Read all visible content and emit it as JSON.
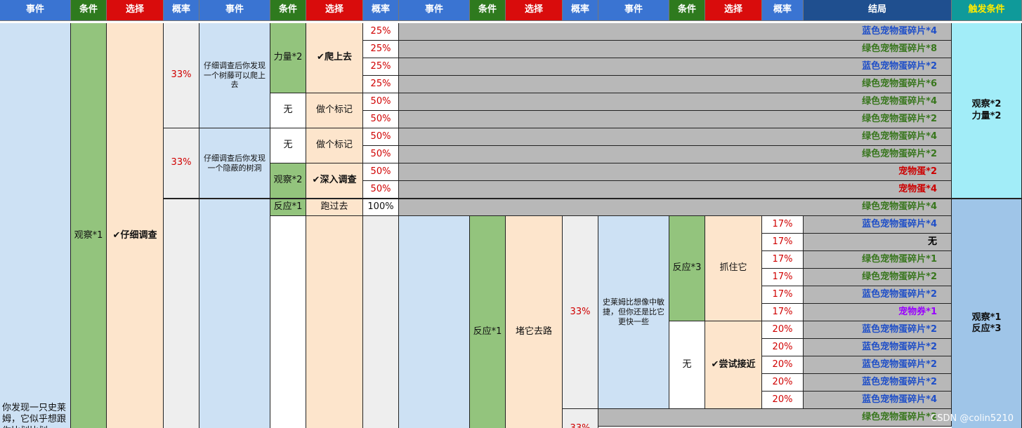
{
  "colors": {
    "header_blue": "#3a74d2",
    "header_green": "#2e7a1e",
    "header_red": "#d90c0c",
    "header_navy": "#1f4f8f",
    "header_teal": "#0f9a9a",
    "result_blue": "#1f4fc8",
    "result_green": "#38761d",
    "result_red": "#cc0000",
    "result_purple": "#9900ff"
  },
  "headers": [
    "事件",
    "条件",
    "选择",
    "概率",
    "事件",
    "条件",
    "选择",
    "概率",
    "事件",
    "条件",
    "选择",
    "概率",
    "事件",
    "条件",
    "选择",
    "概率",
    "结局",
    "触发条件"
  ],
  "main": {
    "event_text": "你发现一只史莱姆，它似乎想跟你比划比划，一直在挑衅",
    "condition": "观察*1",
    "choice": "✔仔细调查"
  },
  "branch_a": {
    "prob": "33%",
    "event": "仔细调查后你发现一个树藤可以爬上去",
    "cond_1": "力量*2",
    "choice_1": "✔爬上去",
    "cond_2": "无",
    "choice_2": "做个标记",
    "trigger": "观察*2\n力量*2"
  },
  "branch_b": {
    "prob": "33%",
    "event": "仔细调查后你发现一个隐蔽的树洞",
    "cond_1": "无",
    "choice_1": "做个标记",
    "cond_2": "观察*2",
    "choice_2": "✔深入调查"
  },
  "branch_c": {
    "cond_run": "反应*1",
    "choice_run": "跑过去",
    "prob_run": "100%",
    "cond_block": "反应*1",
    "choice_block": "堵它去路",
    "prob_block": "33%",
    "event_2": "史莱姆比想像中敏捷，但你还是比它更快一些",
    "cond_catch": "反应*3",
    "choice_catch": "抓住它",
    "cond_approach": "无",
    "choice_approach": "✔尝试接近",
    "prob_last": "33%",
    "trigger": "观察*1\n反应*3"
  },
  "rows": [
    {
      "prob": "25%",
      "result": "蓝色宠物蛋碎片*4",
      "color": "blue"
    },
    {
      "prob": "25%",
      "result": "绿色宠物蛋碎片*8",
      "color": "green"
    },
    {
      "prob": "25%",
      "result": "蓝色宠物蛋碎片*2",
      "color": "blue"
    },
    {
      "prob": "25%",
      "result": "绿色宠物蛋碎片*6",
      "color": "green"
    },
    {
      "prob": "50%",
      "result": "绿色宠物蛋碎片*4",
      "color": "green"
    },
    {
      "prob": "50%",
      "result": "绿色宠物蛋碎片*2",
      "color": "green"
    },
    {
      "prob": "50%",
      "result": "绿色宠物蛋碎片*4",
      "color": "green"
    },
    {
      "prob": "50%",
      "result": "绿色宠物蛋碎片*2",
      "color": "green"
    },
    {
      "prob": "50%",
      "result": "宠物蛋*2",
      "color": "red"
    },
    {
      "prob": "50%",
      "result": "宠物蛋*4",
      "color": "red"
    },
    {
      "prob": "",
      "result": "绿色宠物蛋碎片*4",
      "color": "green"
    },
    {
      "prob": "17%",
      "result": "蓝色宠物蛋碎片*4",
      "color": "blue"
    },
    {
      "prob": "17%",
      "result": "无",
      "color": "black"
    },
    {
      "prob": "17%",
      "result": "绿色宠物蛋碎片*1",
      "color": "green"
    },
    {
      "prob": "17%",
      "result": "绿色宠物蛋碎片*2",
      "color": "green"
    },
    {
      "prob": "17%",
      "result": "蓝色宠物蛋碎片*2",
      "color": "blue"
    },
    {
      "prob": "17%",
      "result": "宠物券*1",
      "color": "purple"
    },
    {
      "prob": "20%",
      "result": "蓝色宠物蛋碎片*2",
      "color": "blue"
    },
    {
      "prob": "20%",
      "result": "蓝色宠物蛋碎片*2",
      "color": "blue"
    },
    {
      "prob": "20%",
      "result": "蓝色宠物蛋碎片*2",
      "color": "blue"
    },
    {
      "prob": "20%",
      "result": "蓝色宠物蛋碎片*2",
      "color": "blue"
    },
    {
      "prob": "20%",
      "result": "蓝色宠物蛋碎片*4",
      "color": "blue"
    },
    {
      "prob": "",
      "result": "绿色宠物蛋碎片*2",
      "color": "green"
    }
  ],
  "watermark": "CSDN @colin5210"
}
